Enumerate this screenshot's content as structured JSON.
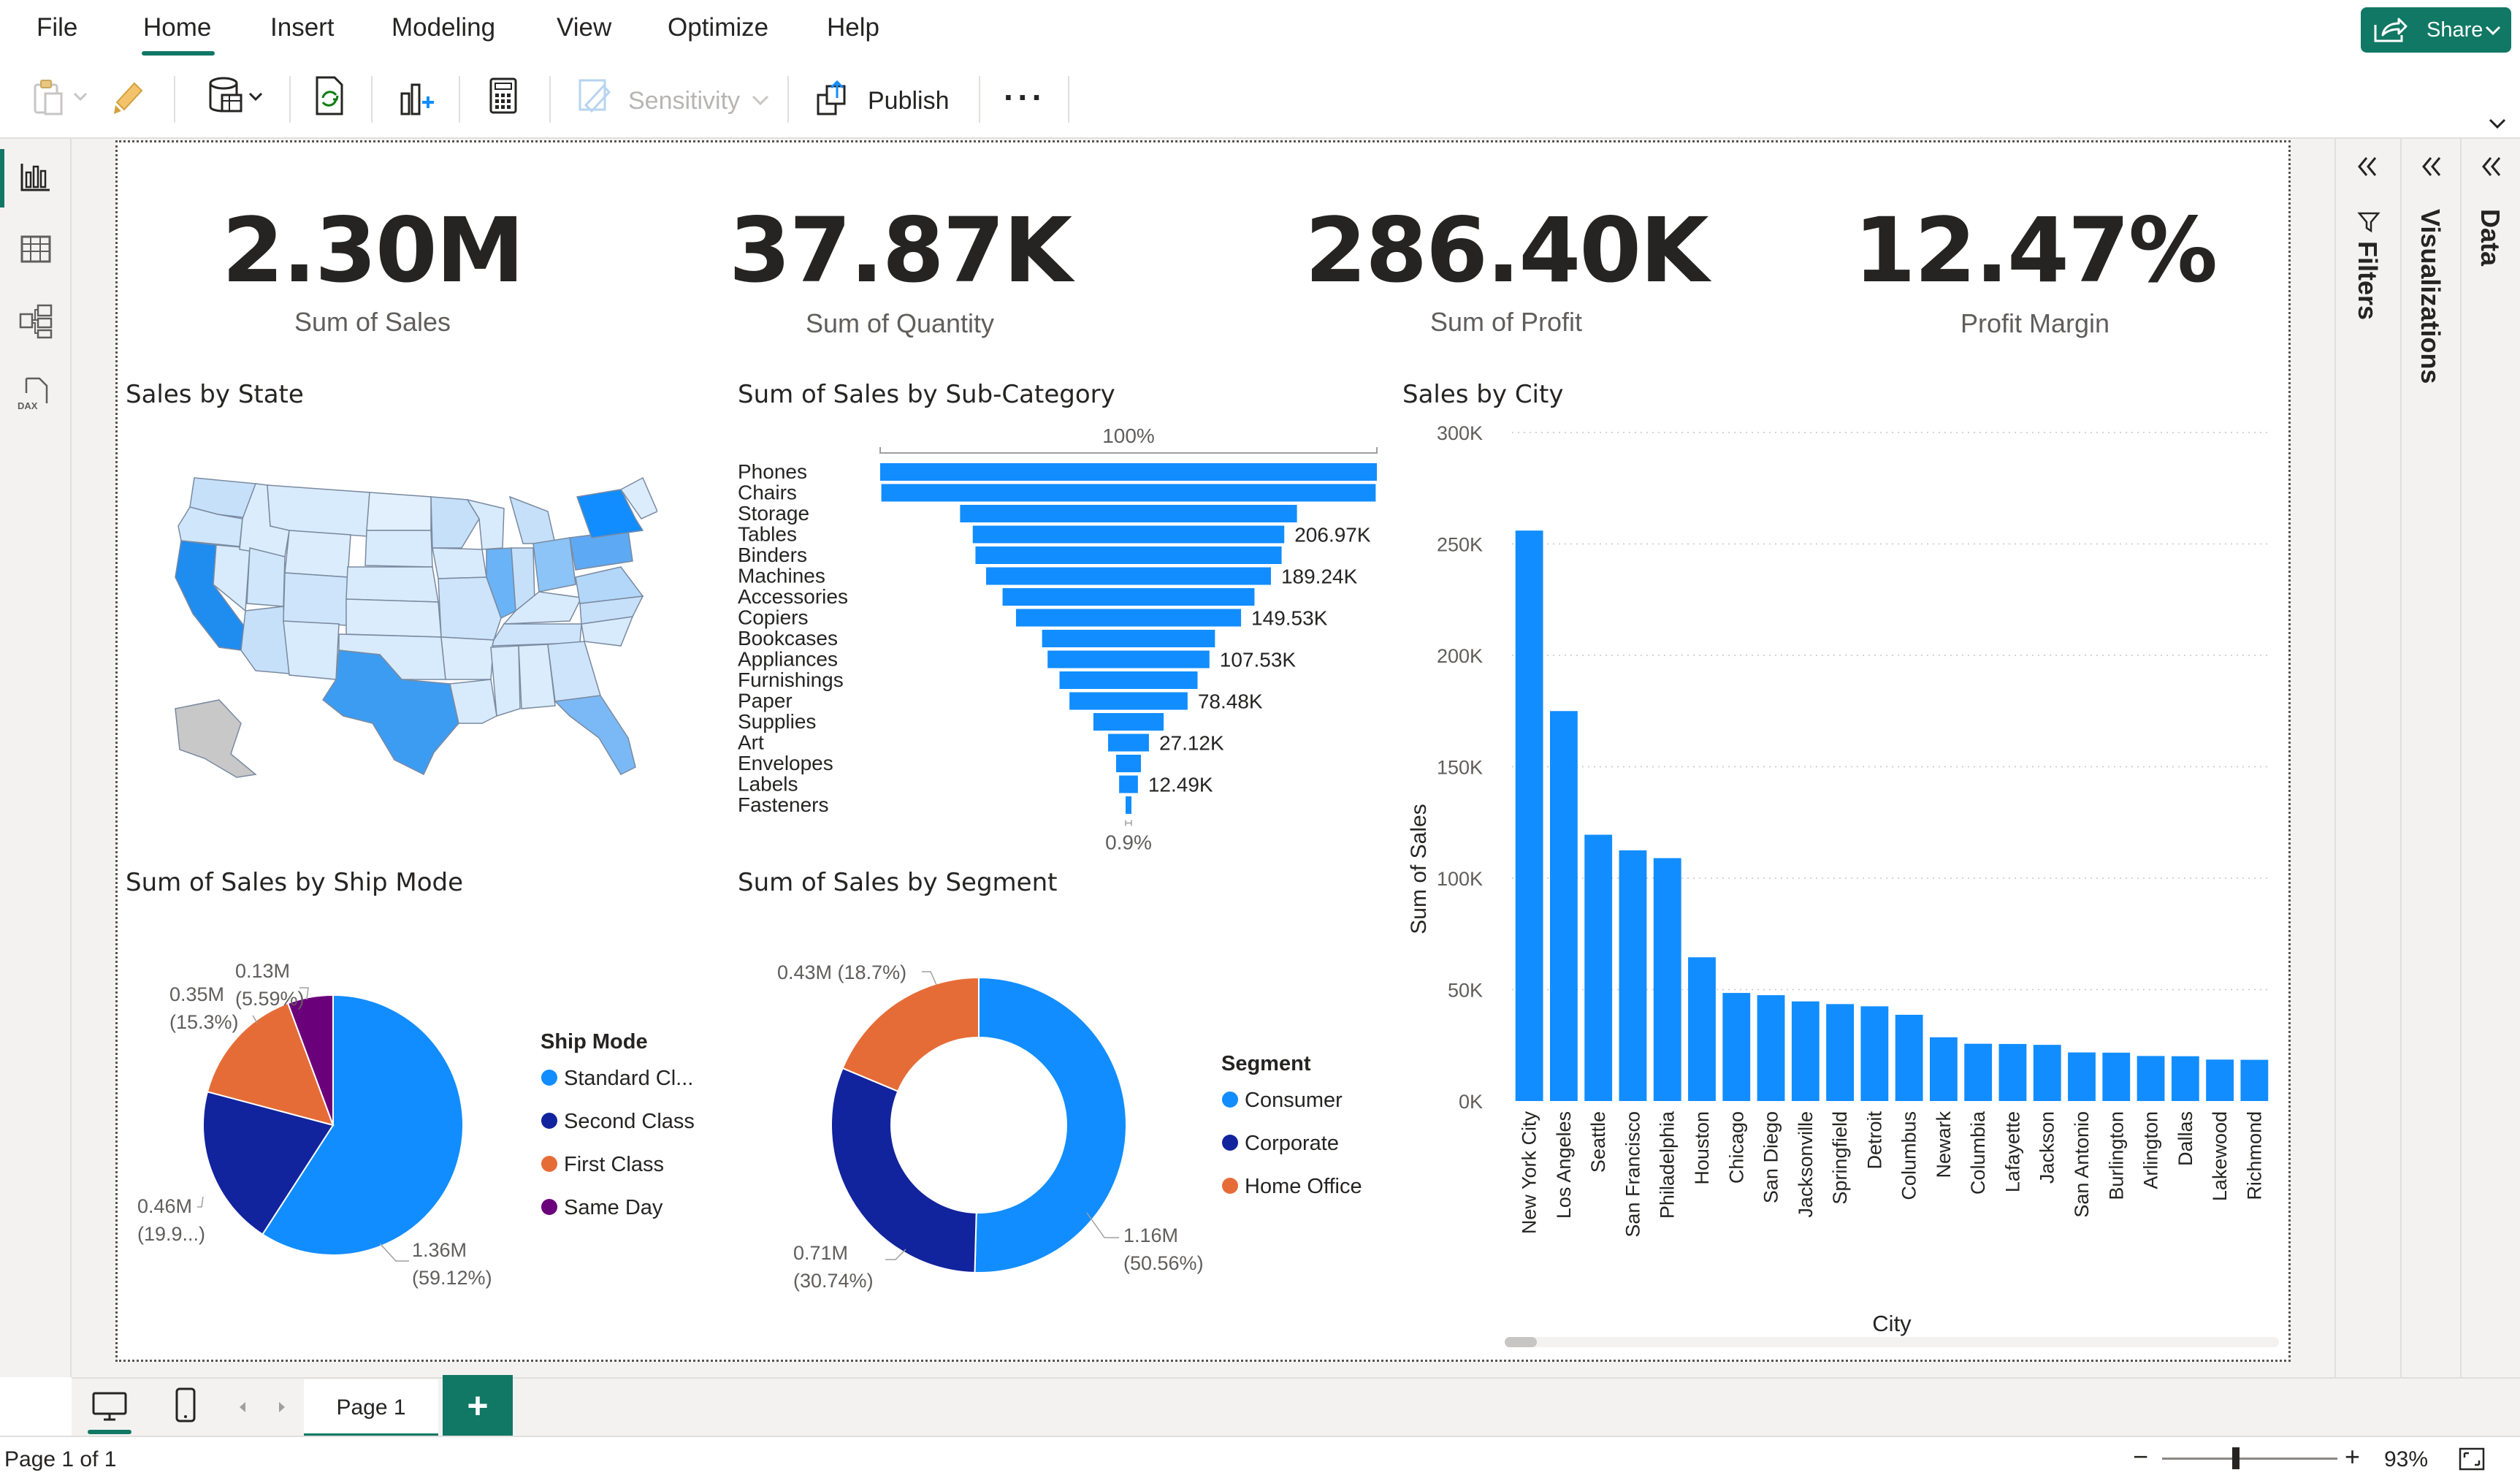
{
  "menu": {
    "items": [
      "File",
      "Home",
      "Insert",
      "Modeling",
      "View",
      "Optimize",
      "Help"
    ],
    "active": "Home",
    "share_label": "Share"
  },
  "ribbon": {
    "sensitivity_label": "Sensitivity",
    "publish_label": "Publish",
    "more_label": "···"
  },
  "panes": {
    "filters_label": "Filters",
    "visualizations_label": "Visualizations",
    "data_label": "Data"
  },
  "kpis": [
    {
      "value": "2.30M",
      "label": "Sum of Sales"
    },
    {
      "value": "37.87K",
      "label": "Sum of Quantity"
    },
    {
      "value": "286.40K",
      "label": "Sum of Profit"
    },
    {
      "value": "12.47%",
      "label": "Profit Margin"
    }
  ],
  "visuals": {
    "map_title": "Sales by State",
    "funnel_title": "Sum of Sales by Sub-Category",
    "city_title": "Sales by City",
    "shipmode_title": "Sum of Sales by Ship Mode",
    "segment_title": "Sum of Sales by Segment"
  },
  "chart_data": [
    {
      "type": "bar",
      "orientation": "horizontal-funnel",
      "title": "Sum of Sales by Sub-Category",
      "top_label": "100%",
      "bottom_label": "0.9%",
      "categories": [
        "Phones",
        "Chairs",
        "Storage",
        "Tables",
        "Binders",
        "Machines",
        "Accessories",
        "Copiers",
        "Bookcases",
        "Appliances",
        "Furnishings",
        "Paper",
        "Supplies",
        "Art",
        "Envelopes",
        "Labels",
        "Fasteners"
      ],
      "values": [
        330010,
        328450,
        223840,
        206970,
        203410,
        189240,
        167380,
        149530,
        114880,
        107530,
        91710,
        78480,
        46670,
        27120,
        16480,
        12490,
        3020
      ],
      "data_labels": [
        "",
        "",
        "",
        "206.97K",
        "",
        "189.24K",
        "",
        "149.53K",
        "",
        "107.53K",
        "",
        "78.48K",
        "",
        "27.12K",
        "",
        "12.49K",
        ""
      ]
    },
    {
      "type": "bar",
      "title": "Sales by City",
      "xlabel": "City",
      "ylabel": "Sum of Sales",
      "ylim": [
        0,
        300000
      ],
      "yticks": [
        "0K",
        "50K",
        "100K",
        "150K",
        "200K",
        "250K",
        "300K"
      ],
      "grid": true,
      "categories": [
        "New York City",
        "Los Angeles",
        "Seattle",
        "San Francisco",
        "Philadelphia",
        "Houston",
        "Chicago",
        "San Diego",
        "Jacksonville",
        "Springfield",
        "Detroit",
        "Columbus",
        "Newark",
        "Columbia",
        "Lafayette",
        "Jackson",
        "San Antonio",
        "Burlington",
        "Arlington",
        "Dallas",
        "Lakewood",
        "Richmond"
      ],
      "values": [
        256000,
        175000,
        119500,
        112500,
        109000,
        64500,
        48500,
        47500,
        44700,
        43500,
        42500,
        38700,
        28600,
        25700,
        25600,
        25200,
        21800,
        21700,
        20200,
        20100,
        18600,
        18500
      ]
    },
    {
      "type": "pie",
      "title": "Sum of Sales by Ship Mode",
      "legend_title": "Ship Mode",
      "legend_position": "right",
      "categories": [
        "Standard Cl...",
        "Second Class",
        "First Class",
        "Same Day"
      ],
      "values": [
        1.36,
        0.46,
        0.35,
        0.13
      ],
      "percents": [
        59.12,
        19.9,
        15.3,
        5.59
      ],
      "labels": [
        "1.36M\n(59.12%)",
        "0.46M\n(19.9...)",
        "0.35M\n(15.3%)",
        "0.13M\n(5.59%)"
      ],
      "colors": [
        "#118dff",
        "#12239e",
        "#e66c37",
        "#6b007b"
      ]
    },
    {
      "type": "pie",
      "style": "donut",
      "title": "Sum of Sales by Segment",
      "legend_title": "Segment",
      "legend_position": "right",
      "categories": [
        "Consumer",
        "Corporate",
        "Home Office"
      ],
      "values": [
        1.16,
        0.71,
        0.43
      ],
      "percents": [
        50.56,
        30.74,
        18.7
      ],
      "labels": [
        "1.16M\n(50.56%)",
        "0.71M\n(30.74%)",
        "0.43M (18.7%)"
      ],
      "colors": [
        "#118dff",
        "#12239e",
        "#e66c37"
      ]
    }
  ],
  "footer": {
    "page_tab": "Page 1",
    "add_page": "+",
    "status": "Page 1 of 1",
    "zoom": "93%"
  }
}
